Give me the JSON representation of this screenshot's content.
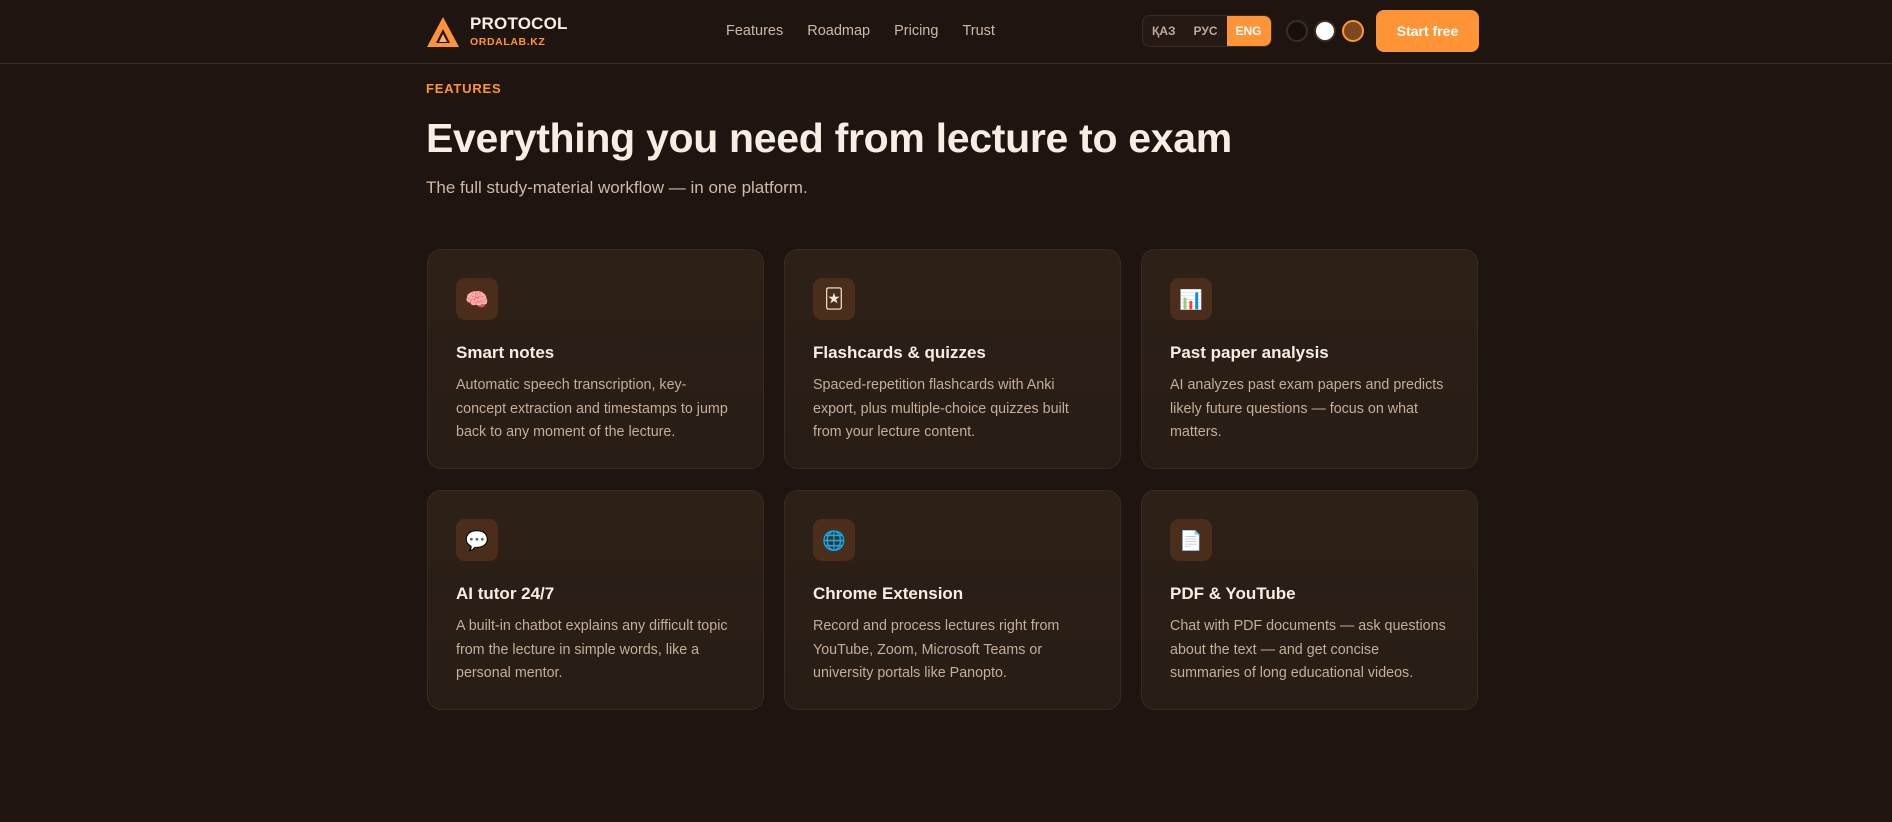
{
  "header": {
    "brand_name": "PROTOCOL",
    "brand_sub": "ORDALAB.KZ",
    "nav": [
      "Features",
      "Roadmap",
      "Pricing",
      "Trust"
    ],
    "languages": [
      "ҚАЗ",
      "РУС",
      "ENG"
    ],
    "active_language": "ENG",
    "theme_swatches": [
      "dark",
      "light",
      "warm"
    ],
    "cta_label": "Start free"
  },
  "hero": {
    "eyebrow": "FEATURES",
    "title": "Everything you need from lecture to exam",
    "subtitle": "The full study-material workflow — in one platform."
  },
  "features": [
    {
      "icon": "🧠",
      "icon_name": "brain-icon",
      "title": "Smart notes",
      "description": "Automatic speech transcription, key-concept extraction and timestamps to jump back to any moment of the lecture."
    },
    {
      "icon": "🃏",
      "icon_name": "card-icon",
      "title": "Flashcards & quizzes",
      "description": "Spaced-repetition flashcards with Anki export, plus multiple-choice quizzes built from your lecture content."
    },
    {
      "icon": "📊",
      "icon_name": "bar-chart-icon",
      "title": "Past paper analysis",
      "description": "AI analyzes past exam papers and predicts likely future questions — focus on what matters."
    },
    {
      "icon": "💬",
      "icon_name": "speech-bubble-icon",
      "title": "AI tutor 24/7",
      "description": "A built-in chatbot explains any difficult topic from the lecture in simple words, like a personal mentor."
    },
    {
      "icon": "🌐",
      "icon_name": "globe-icon",
      "title": "Chrome Extension",
      "description": "Record and process lectures right from YouTube, Zoom, Microsoft Teams or university portals like Panopto."
    },
    {
      "icon": "📄",
      "icon_name": "document-icon",
      "title": "PDF & YouTube",
      "description": "Chat with PDF documents — ask questions about the text — and get concise summaries of long educational videos."
    }
  ],
  "colors": {
    "background": "#1f1510",
    "accent": "#ff9436",
    "card": "#2a1e16",
    "icon_tile": "#4a2e1b"
  }
}
